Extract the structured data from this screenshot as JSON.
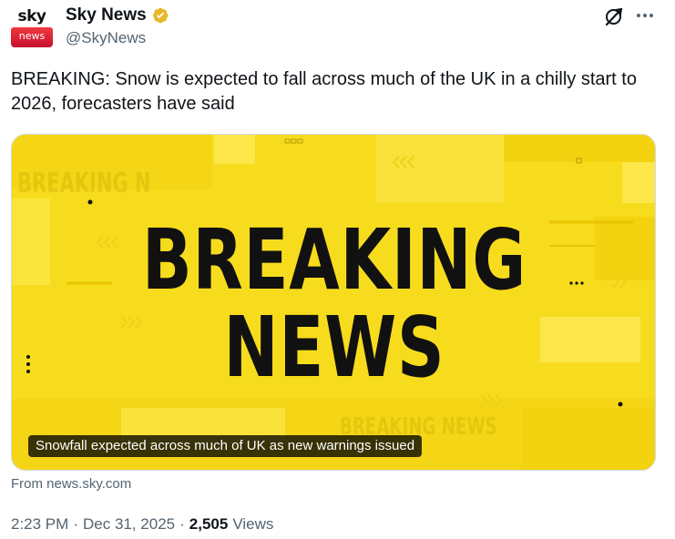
{
  "account": {
    "avatar_top": "sky",
    "avatar_bottom": "news",
    "display_name": "Sky News",
    "handle": "@SkyNews"
  },
  "header_icons": {
    "grok": "grok-icon",
    "more": "more-icon",
    "verified": "verified-badge-icon",
    "verified_color": "#e8b829"
  },
  "tweet": {
    "text": "BREAKING: Snow is expected to fall across much of the UK in a chilly start to 2026, forecasters have said"
  },
  "card": {
    "headline_line1": "BREAKING",
    "headline_line2": "NEWS",
    "ghost_text_1": "BREAKING N",
    "ghost_text_2": "BREAKING NEWS",
    "caption": "Snowfall expected across much of UK as new warnings issued",
    "background_color": "#f7dc1e",
    "source": "From news.sky.com"
  },
  "meta": {
    "time": "2:23 PM",
    "date": "Dec 31, 2025",
    "view_count": "2,505",
    "views_label": "Views",
    "separator": "·"
  }
}
